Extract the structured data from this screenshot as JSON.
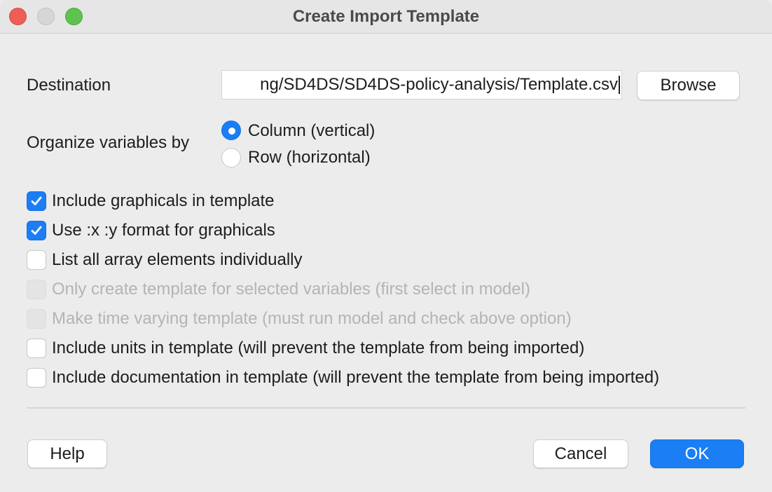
{
  "window": {
    "title": "Create Import Template"
  },
  "destination": {
    "label": "Destination",
    "value": "ng/SD4DS/SD4DS-policy-analysis/Template.csv",
    "browse_label": "Browse"
  },
  "organize": {
    "label": "Organize variables by",
    "options": [
      {
        "label": "Column (vertical)",
        "selected": true
      },
      {
        "label": "Row (horizontal)",
        "selected": false
      }
    ]
  },
  "options": [
    {
      "label": "Include graphicals in template",
      "checked": true,
      "enabled": true
    },
    {
      "label": "Use :x :y format for graphicals",
      "checked": true,
      "enabled": true
    },
    {
      "label": "List all array elements individually",
      "checked": false,
      "enabled": true
    },
    {
      "label": "Only create template for selected variables (first select in model)",
      "checked": false,
      "enabled": false
    },
    {
      "label": "Make time varying template (must run model and check above option)",
      "checked": false,
      "enabled": false
    },
    {
      "label": "Include units in template (will prevent the template from being imported)",
      "checked": false,
      "enabled": true
    },
    {
      "label": "Include documentation in template (will prevent the template from being imported)",
      "checked": false,
      "enabled": true
    }
  ],
  "buttons": {
    "help": "Help",
    "cancel": "Cancel",
    "ok": "OK"
  },
  "colors": {
    "accent": "#1b7ef5",
    "close": "#ee5e56",
    "maximize": "#5fc250"
  }
}
